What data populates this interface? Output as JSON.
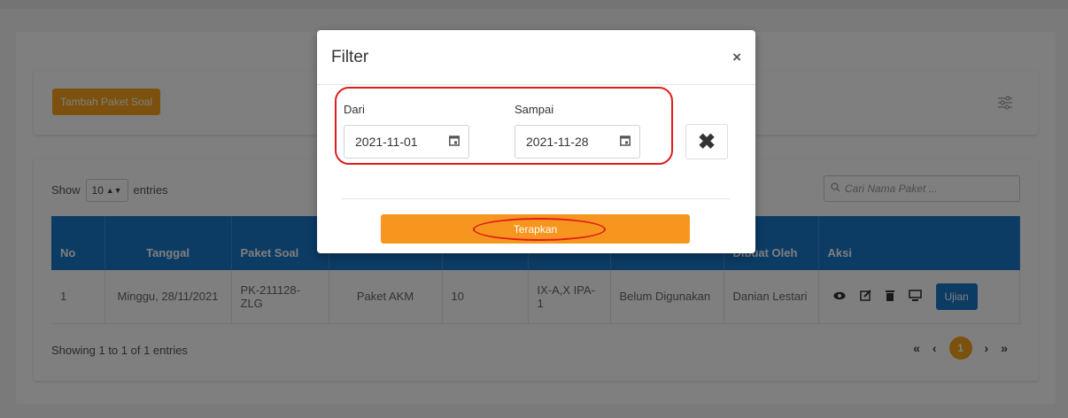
{
  "page": {
    "add_button_label": "Tambah Paket Soal",
    "show_label": "Show",
    "entries_value": "10",
    "entries_label": "entries",
    "search_placeholder": "Cari Nama Paket ...",
    "columns": [
      "No",
      "Tanggal",
      "Paket Soal",
      "",
      "",
      "",
      "",
      "Dibuat Oleh",
      "Aksi"
    ],
    "row": {
      "no": "1",
      "tanggal": "Minggu, 28/11/2021",
      "paket_soal": "PK-211128-ZLG",
      "nama": "Paket AKM",
      "jumlah": "10",
      "kelas": "IX-A,X IPA-1",
      "status": "Belum Digunakan",
      "dibuat_oleh": "Danian Lestari",
      "ujian_label": "Ujian"
    },
    "showing_text": "Showing 1 to 1 of 1 entries",
    "pager": {
      "first": "«",
      "prev": "‹",
      "current": "1",
      "next": "›",
      "last": "»"
    }
  },
  "modal": {
    "title": "Filter",
    "close": "×",
    "dari_label": "Dari",
    "dari_value": "2021-11-01",
    "sampai_label": "Sampai",
    "sampai_value": "2021-11-28",
    "clear_symbol": "✖",
    "apply_label": "Terapkan"
  },
  "colors": {
    "accent_orange": "#f7961e",
    "header_blue": "#1877c8",
    "annotation_red": "#e01d1d"
  },
  "icons": [
    "filter-sliders-icon",
    "search-icon",
    "calendar-icon",
    "eye-icon",
    "edit-icon",
    "trash-icon",
    "monitor-icon"
  ]
}
